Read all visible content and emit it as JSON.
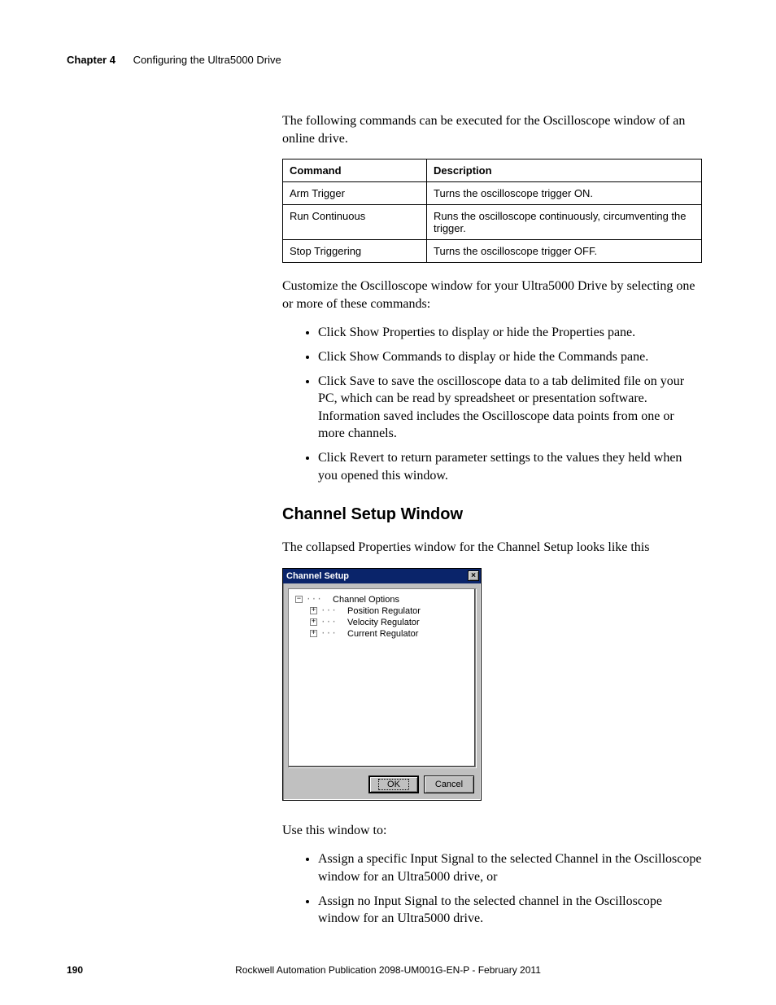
{
  "header": {
    "chapter": "Chapter 4",
    "title": "Configuring the Ultra5000 Drive"
  },
  "intro_para": "The following commands can be executed for the Oscilloscope window of an online drive.",
  "command_table": {
    "headers": {
      "col1": "Command",
      "col2": "Description"
    },
    "rows": [
      {
        "cmd": "Arm Trigger",
        "desc": "Turns the oscilloscope trigger ON."
      },
      {
        "cmd": "Run Continuous",
        "desc": "Runs the oscilloscope continuously, circumventing the trigger."
      },
      {
        "cmd": "Stop Triggering",
        "desc": "Turns the oscilloscope trigger OFF."
      }
    ]
  },
  "customize_para": "Customize the Oscilloscope window for your Ultra5000 Drive by selecting one or more of these commands:",
  "customize_bullets": [
    "Click Show Properties to display or hide the Properties pane.",
    "Click Show Commands to display or hide the Commands pane.",
    "Click Save to save the oscilloscope data to a tab delimited file on your PC, which can be read by spreadsheet or presentation software. Information saved includes the Oscilloscope data points from one or more channels.",
    "Click Revert to return parameter settings to the values they held when you opened this window."
  ],
  "section_heading": "Channel Setup Window",
  "section_intro": "The collapsed Properties window for the Channel Setup looks like this",
  "dialog": {
    "title": "Channel Setup",
    "close_glyph": "×",
    "tree": {
      "root": {
        "toggle": "−",
        "label": "Channel Options"
      },
      "children": [
        {
          "toggle": "+",
          "label": "Position Regulator"
        },
        {
          "toggle": "+",
          "label": "Velocity Regulator"
        },
        {
          "toggle": "+",
          "label": "Current Regulator"
        }
      ]
    },
    "buttons": {
      "ok": "OK",
      "cancel": "Cancel"
    }
  },
  "use_para": "Use this window to:",
  "use_bullets": [
    "Assign a specific Input Signal to the selected Channel in the Oscilloscope window for an Ultra5000 drive, or",
    "Assign no Input Signal to the selected channel in the Oscilloscope window for an Ultra5000 drive."
  ],
  "footer": {
    "page": "190",
    "publication": "Rockwell Automation Publication 2098-UM001G-EN-P  - February 2011"
  }
}
